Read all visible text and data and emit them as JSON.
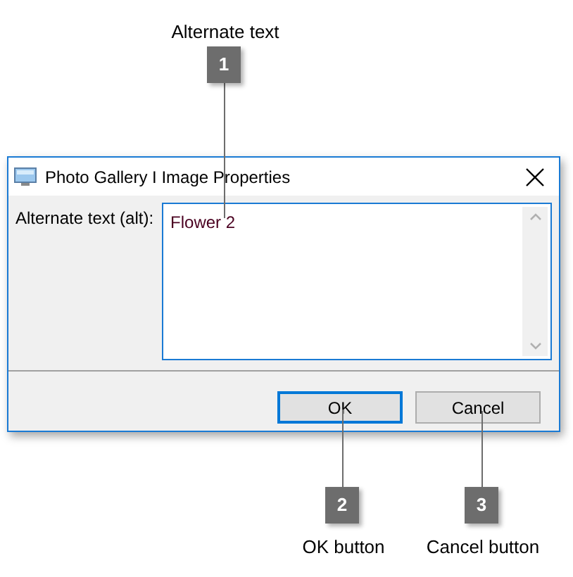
{
  "callouts": [
    {
      "number": "1",
      "label": "Alternate text"
    },
    {
      "number": "2",
      "label": "OK button"
    },
    {
      "number": "3",
      "label": "Cancel button"
    }
  ],
  "dialog": {
    "title": "Photo Gallery I Image Properties",
    "field": {
      "label": "Alternate text (alt):",
      "value": "Flower 2"
    },
    "buttons": [
      {
        "label": "OK",
        "selected": true
      },
      {
        "label": "Cancel",
        "selected": false
      }
    ]
  }
}
